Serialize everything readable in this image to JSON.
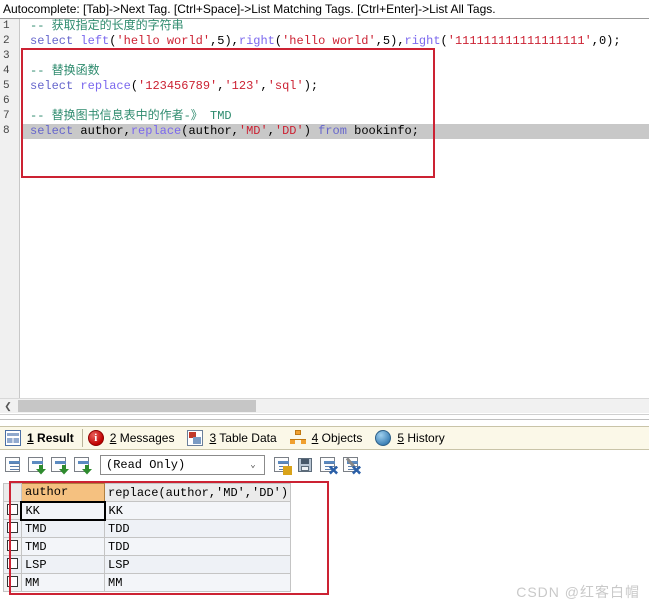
{
  "hint_bar": {
    "text": "Autocomplete: [Tab]->Next Tag. [Ctrl+Space]->List Matching Tags. [Ctrl+Enter]->List All Tags."
  },
  "editor": {
    "line_numbers": [
      "1",
      "2",
      "3",
      "4",
      "5",
      "6",
      "7",
      "8"
    ],
    "lines": [
      {
        "n": "1",
        "selected": false,
        "tokens": [
          {
            "t": "-- 获取指定的长度的字符串",
            "c": "comment"
          }
        ]
      },
      {
        "n": "2",
        "selected": false,
        "tokens": [
          {
            "t": "select ",
            "c": "kw"
          },
          {
            "t": "left",
            "c": "fn"
          },
          {
            "t": "(",
            "c": "punc"
          },
          {
            "t": "'hello world'",
            "c": "str"
          },
          {
            "t": ",5),",
            "c": "punc"
          },
          {
            "t": "right",
            "c": "fn"
          },
          {
            "t": "(",
            "c": "punc"
          },
          {
            "t": "'hello world'",
            "c": "str"
          },
          {
            "t": ",5),",
            "c": "punc"
          },
          {
            "t": "right",
            "c": "fn"
          },
          {
            "t": "(",
            "c": "punc"
          },
          {
            "t": "'111111111111111111'",
            "c": "str"
          },
          {
            "t": ",0);",
            "c": "punc"
          }
        ]
      },
      {
        "n": "3",
        "selected": false,
        "tokens": []
      },
      {
        "n": "4",
        "selected": false,
        "tokens": [
          {
            "t": "-- 替换函数",
            "c": "comment"
          }
        ]
      },
      {
        "n": "5",
        "selected": false,
        "tokens": [
          {
            "t": "select ",
            "c": "kw"
          },
          {
            "t": "replace",
            "c": "fn"
          },
          {
            "t": "(",
            "c": "punc"
          },
          {
            "t": "'123456789'",
            "c": "str"
          },
          {
            "t": ",",
            "c": "punc"
          },
          {
            "t": "'123'",
            "c": "str"
          },
          {
            "t": ",",
            "c": "punc"
          },
          {
            "t": "'sql'",
            "c": "str"
          },
          {
            "t": ");",
            "c": "punc"
          }
        ]
      },
      {
        "n": "6",
        "selected": false,
        "tokens": []
      },
      {
        "n": "7",
        "selected": false,
        "tokens": [
          {
            "t": "-- 替换图书信息表中的作者-》 TMD",
            "c": "comment"
          }
        ]
      },
      {
        "n": "8",
        "selected": true,
        "tokens": [
          {
            "t": "select ",
            "c": "kw"
          },
          {
            "t": "author,",
            "c": "plain"
          },
          {
            "t": "replace",
            "c": "fn"
          },
          {
            "t": "(author,",
            "c": "plain"
          },
          {
            "t": "'MD'",
            "c": "str"
          },
          {
            "t": ",",
            "c": "plain"
          },
          {
            "t": "'DD'",
            "c": "str"
          },
          {
            "t": ") ",
            "c": "plain"
          },
          {
            "t": "from ",
            "c": "kw"
          },
          {
            "t": "bookinfo;",
            "c": "plain"
          }
        ]
      }
    ]
  },
  "scrollbar": {
    "left_arrow_glyph": "❮"
  },
  "tabs": [
    {
      "num": "1",
      "label": "Result",
      "icon": "grid-icon",
      "active": true
    },
    {
      "num": "2",
      "label": "Messages",
      "icon": "info-icon",
      "active": false
    },
    {
      "num": "3",
      "label": "Table Data",
      "icon": "table-icon",
      "active": false
    },
    {
      "num": "4",
      "label": "Objects",
      "icon": "objects-icon",
      "active": false
    },
    {
      "num": "5",
      "label": "History",
      "icon": "history-icon",
      "active": false
    }
  ],
  "result_toolbar": {
    "buttons": [
      {
        "name": "grid-view-button",
        "icon": "grid-sheet-icon"
      },
      {
        "name": "export-row-button",
        "icon": "sheet-down-green-icon"
      },
      {
        "name": "export-selection-button",
        "icon": "sheet-down-green-icon"
      },
      {
        "name": "export-all-button",
        "icon": "sheet-down-green-icon"
      },
      {
        "name": "add-row-button",
        "icon": "sheet-plus-icon"
      },
      {
        "name": "save-button",
        "icon": "floppy-icon"
      },
      {
        "name": "delete-row-button",
        "icon": "sheet-delete-icon"
      },
      {
        "name": "clear-button",
        "icon": "sheet-edit-delete-icon"
      }
    ],
    "mode_select": {
      "value": "(Read Only)",
      "chevron": "⌄"
    }
  },
  "result_grid": {
    "columns": [
      "author",
      "replace(author,'MD','DD')"
    ],
    "rows": [
      {
        "cells": [
          "KK",
          "KK"
        ],
        "selected": true,
        "indent": false
      },
      {
        "cells": [
          "TMD",
          "TDD"
        ],
        "selected": false,
        "indent": false
      },
      {
        "cells": [
          "TMD",
          "TDD"
        ],
        "selected": false,
        "indent": false
      },
      {
        "cells": [
          "LSP",
          "LSP"
        ],
        "selected": false,
        "indent": false
      },
      {
        "cells": [
          "MM",
          "MM"
        ],
        "selected": false,
        "indent": true
      }
    ]
  },
  "watermark": {
    "text": "CSDN @红客白帽"
  },
  "colors": {
    "annotation_red": "#cc2233",
    "tabbar_bg": "#fbf8e8",
    "header_orange": "#f5c180",
    "selection_gray": "#c8c8c8",
    "comment_green": "#2e8b6e",
    "string_red": "#cc2233",
    "keyword_blue": "#6666cc"
  }
}
